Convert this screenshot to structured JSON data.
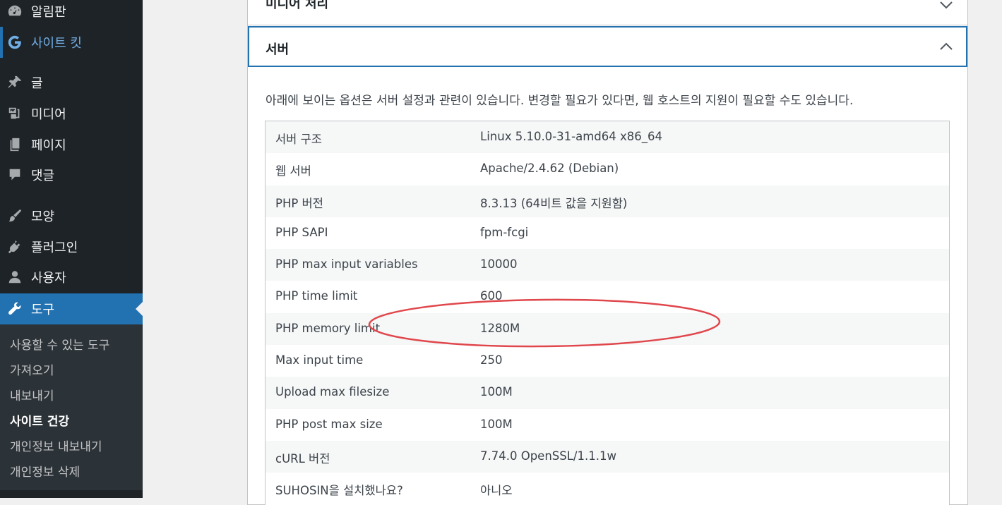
{
  "sidebar": {
    "items": [
      {
        "label": "알림판",
        "icon": "dashboard-icon"
      },
      {
        "label": "사이트 킷",
        "icon": "google-g-icon"
      },
      {
        "label": "글",
        "icon": "pin-icon"
      },
      {
        "label": "미디어",
        "icon": "media-icon"
      },
      {
        "label": "페이지",
        "icon": "page-icon"
      },
      {
        "label": "댓글",
        "icon": "comment-icon"
      },
      {
        "label": "모양",
        "icon": "brush-icon"
      },
      {
        "label": "플러그인",
        "icon": "plugin-icon"
      },
      {
        "label": "사용자",
        "icon": "user-icon"
      },
      {
        "label": "도구",
        "icon": "wrench-icon"
      }
    ],
    "submenu": [
      {
        "label": "사용할 수 있는 도구"
      },
      {
        "label": "가져오기"
      },
      {
        "label": "내보내기"
      },
      {
        "label": "사이트 건강"
      },
      {
        "label": "개인정보 내보내기"
      },
      {
        "label": "개인정보 삭제"
      }
    ]
  },
  "sections": {
    "media": {
      "title": "미디어 처리"
    },
    "server": {
      "title": "서버",
      "description": "아래에 보이는 옵션은 서버 설정과 관련이 있습니다. 변경할 필요가 있다면, 웹 호스트의 지원이 필요할 수도 있습니다.",
      "rows": [
        {
          "key": "서버 구조",
          "value": "Linux 5.10.0-31-amd64 x86_64"
        },
        {
          "key": "웹 서버",
          "value": "Apache/2.4.62 (Debian)"
        },
        {
          "key": "PHP 버전",
          "value": "8.3.13 (64비트 값을 지원함)"
        },
        {
          "key": "PHP SAPI",
          "value": "fpm-fcgi"
        },
        {
          "key": "PHP max input variables",
          "value": "10000"
        },
        {
          "key": "PHP time limit",
          "value": "600"
        },
        {
          "key": "PHP memory limit",
          "value": "1280M"
        },
        {
          "key": "Max input time",
          "value": "250"
        },
        {
          "key": "Upload max filesize",
          "value": "100M"
        },
        {
          "key": "PHP post max size",
          "value": "100M"
        },
        {
          "key": "cURL 버전",
          "value": "7.74.0 OpenSSL/1.1.1w"
        },
        {
          "key": "SUHOSIN을 설치했나요?",
          "value": "아니오"
        }
      ]
    }
  },
  "colors": {
    "accent": "#2271b1",
    "sidebar": "#1d2327",
    "highlight": "#e0474c"
  }
}
